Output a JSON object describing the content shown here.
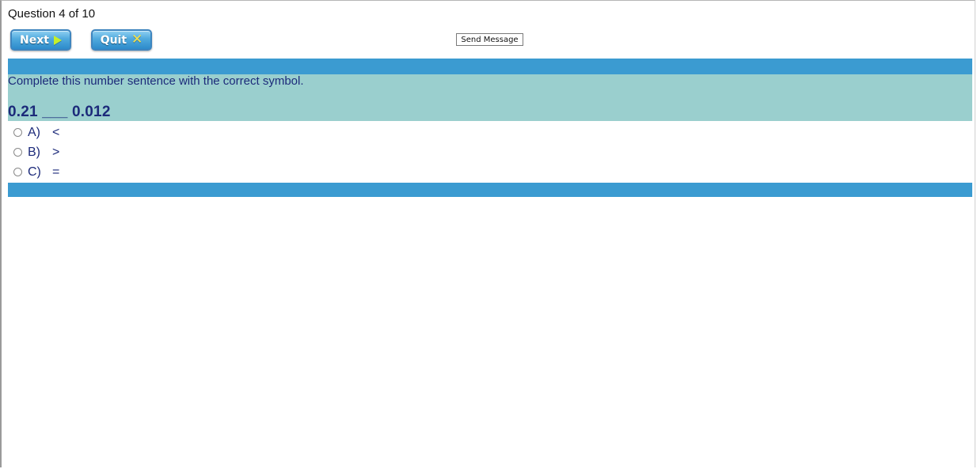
{
  "header": {
    "question_counter": "Question 4 of 10"
  },
  "toolbar": {
    "next_label": "Next",
    "quit_label": "Quit",
    "send_message_label": "Send Message"
  },
  "question": {
    "prompt": "Complete this number sentence with the correct symbol.",
    "sentence": "0.21 ___ 0.012",
    "options": [
      {
        "letter": "A)",
        "symbol": "<"
      },
      {
        "letter": "B)",
        "symbol": ">"
      },
      {
        "letter": "C)",
        "symbol": "="
      }
    ]
  },
  "icons": {
    "next": "play-arrow-icon",
    "quit": "close-x-icon"
  },
  "colors": {
    "band_blue": "#3b9bd1",
    "question_panel": "#9acfce",
    "question_text": "#1c2a7a",
    "button_blue": "#4fa9dd",
    "next_arrow": "#c6f02a",
    "quit_x": "#f4e24a"
  }
}
